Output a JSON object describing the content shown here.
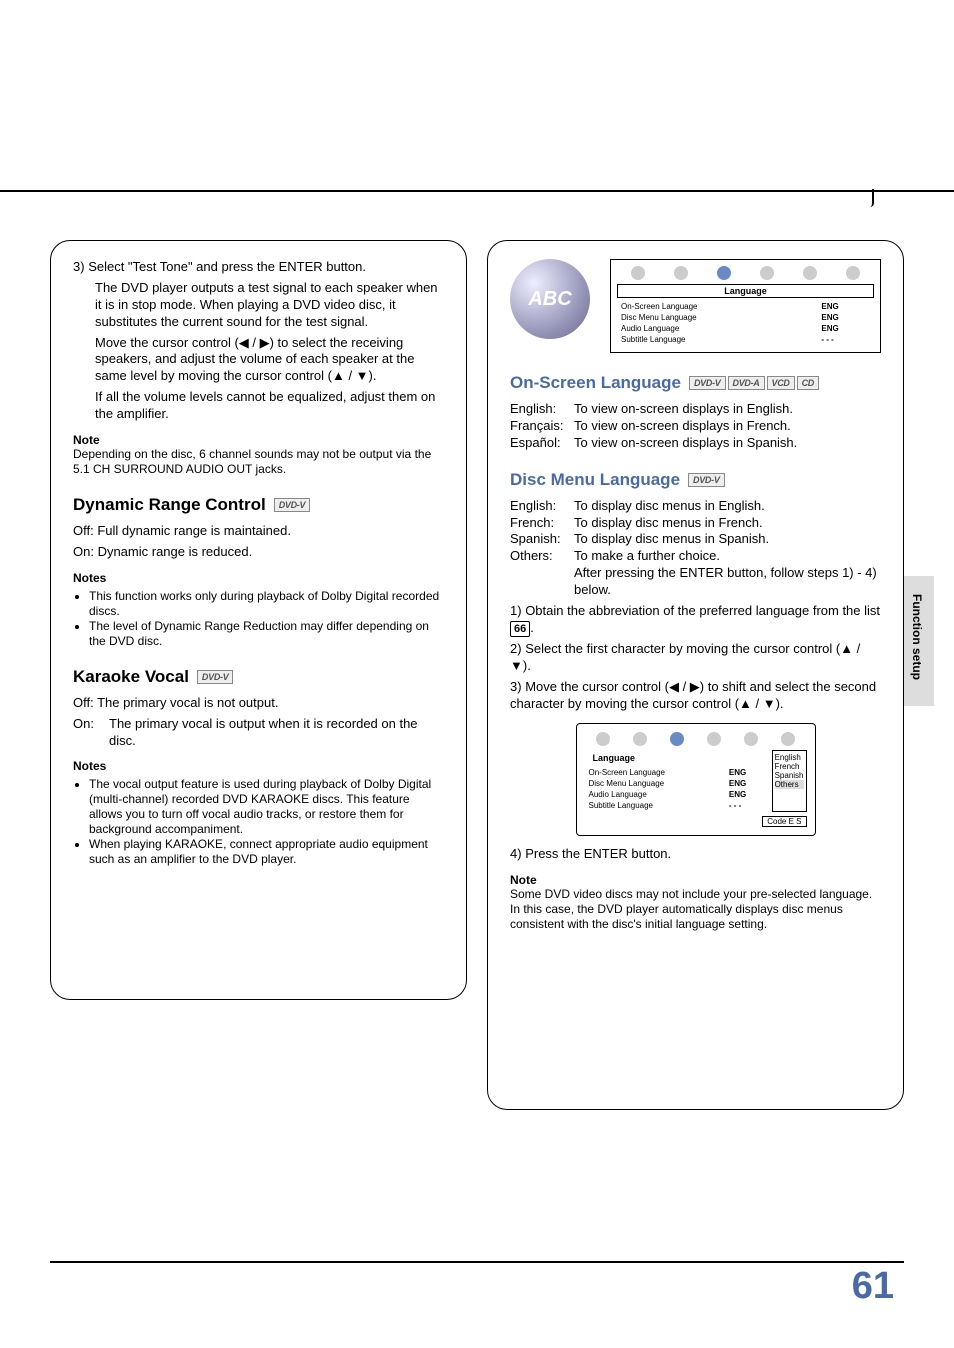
{
  "page_number": "61",
  "side_tab": "Function setup",
  "left": {
    "step3": {
      "num": "3)",
      "line1": "Select \"Test Tone\" and press the ENTER button.",
      "p1": "The DVD player outputs a test signal to each speaker when it is in stop mode. When playing a DVD video disc, it substitutes the current sound for the test signal.",
      "p2": "Move the cursor control (◀ / ▶) to select the receiving speakers, and adjust the volume of each speaker at the same level by moving the cursor control (▲ / ▼).",
      "p3": "If all the volume levels cannot be equalized, adjust them on the amplifier."
    },
    "note1_hd": "Note",
    "note1": "Depending on the disc, 6 channel sounds may not be output via the 5.1 CH SURROUND AUDIO OUT jacks.",
    "drc": {
      "title": "Dynamic Range Control",
      "badge": "DVD-V",
      "off": "Off:  Full dynamic range is maintained.",
      "on": "On:  Dynamic range is reduced.",
      "notes_hd": "Notes",
      "n1": "This function works only during playback of Dolby Digital recorded discs.",
      "n2": "The level of Dynamic Range Reduction may differ depending on the DVD disc."
    },
    "kv": {
      "title": "Karaoke Vocal",
      "badge": "DVD-V",
      "off": "Off:  The primary vocal is not output.",
      "on_k": "On:",
      "on_v": "The primary vocal is output when it is recorded on the disc.",
      "notes_hd": "Notes",
      "n1": "The vocal output feature is used during playback of Dolby Digital (multi-channel) recorded DVD KARAOKE discs. This feature allows you to turn off vocal audio tracks, or restore them for background accompaniment.",
      "n2": "When playing KARAOKE, connect appropriate audio equipment such as an amplifier to the DVD player."
    }
  },
  "right": {
    "globe_text": "ABC",
    "osd1": {
      "hd": "Language",
      "r1k": "On-Screen Language",
      "r1v": "ENG",
      "r2k": "Disc Menu Language",
      "r2v": "ENG",
      "r3k": "Audio Language",
      "r3v": "ENG",
      "r4k": "Subtitle Language",
      "r4v": "- - -"
    },
    "osl": {
      "title": "On-Screen Language",
      "b1": "DVD-V",
      "b2": "DVD-A",
      "b3": "VCD",
      "b4": "CD",
      "en_k": "English:",
      "en_v": "To view on-screen displays in English.",
      "fr_k": "Français:",
      "fr_v": "To view on-screen displays in French.",
      "es_k": "Español:",
      "es_v": "To view on-screen displays in Spanish."
    },
    "dml": {
      "title": "Disc Menu Language",
      "badge": "DVD-V",
      "en_k": "English:",
      "en_v": "To display disc menus in English.",
      "fr_k": "French:",
      "fr_v": "To display disc menus in French.",
      "es_k": "Spanish:",
      "es_v": "To display disc menus in Spanish.",
      "ot_k": "Others:",
      "ot_v": "To make a further choice.",
      "after1": "After pressing the ENTER button, follow steps 1) - 4) below.",
      "s1n": "1)",
      "s1a": "Obtain the abbreviation of the preferred language from the list ",
      "s1ref": "66",
      "s1b": ".",
      "s2n": "2)",
      "s2": "Select the first character by moving the cursor control (▲ / ▼).",
      "s3n": "3)",
      "s3": "Move the cursor control (◀ / ▶) to shift and select the second character by moving the cursor control (▲ / ▼)."
    },
    "osd2": {
      "hd": "Language",
      "r1k": "On-Screen Language",
      "r1v": "ENG",
      "r2k": "Disc Menu Language",
      "r2v": "ENG",
      "r3k": "Audio Language",
      "r3v": "ENG",
      "r4k": "Subtitle Language",
      "r4v": "- - -",
      "opt1": "English",
      "opt2": "French",
      "opt3": "Spanish",
      "opt4": "Others",
      "code": "Code  E  S"
    },
    "s4n": "4)",
    "s4": "Press the ENTER button.",
    "note_hd": "Note",
    "note": "Some DVD video discs may not include your pre-selected language. In this case, the DVD player automatically displays disc menus consistent with the disc's initial language setting."
  }
}
